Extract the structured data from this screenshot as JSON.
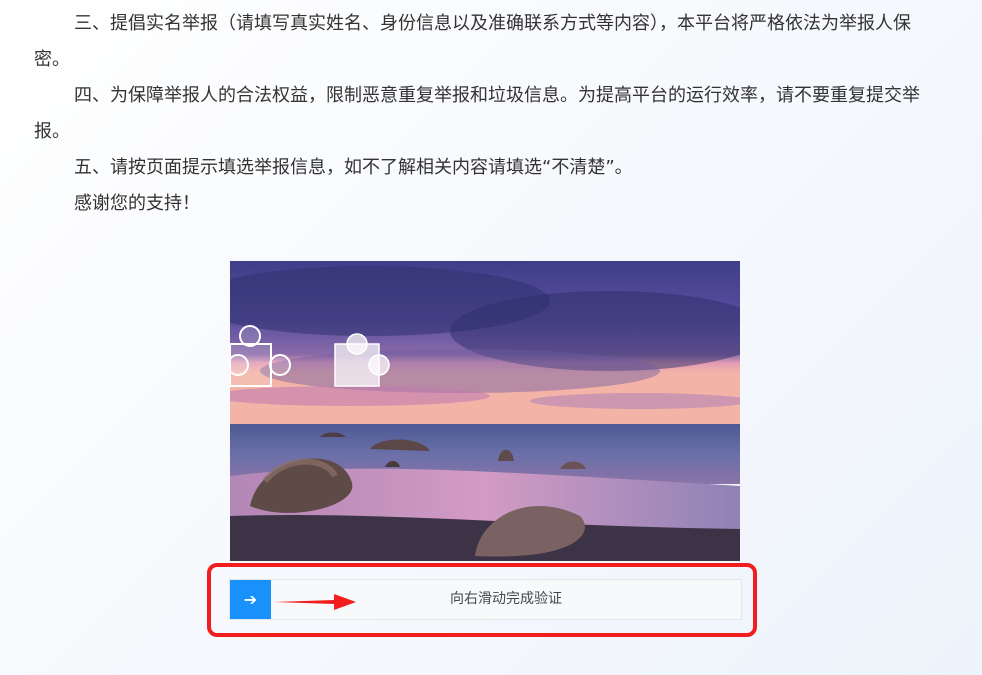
{
  "notice": {
    "paragraphs": [
      "三、提倡实名举报（请填写真实姓名、身份信息以及准确联系方式等内容），本平台将严格依法为举报人保密。",
      "四、为保障举报人的合法权益，限制恶意重复举报和垃圾信息。为提高平台的运行效率，请不要重复提交举报。",
      "五、请按页面提示填选举报信息，如不了解相关内容请填选“不清楚”。",
      "感谢您的支持！"
    ]
  },
  "captcha": {
    "slider_text": "向右滑动完成验证",
    "handle_icon": "arrow-right-icon",
    "accent_color": "#1991fa",
    "highlight_color": "#f21d1d"
  }
}
